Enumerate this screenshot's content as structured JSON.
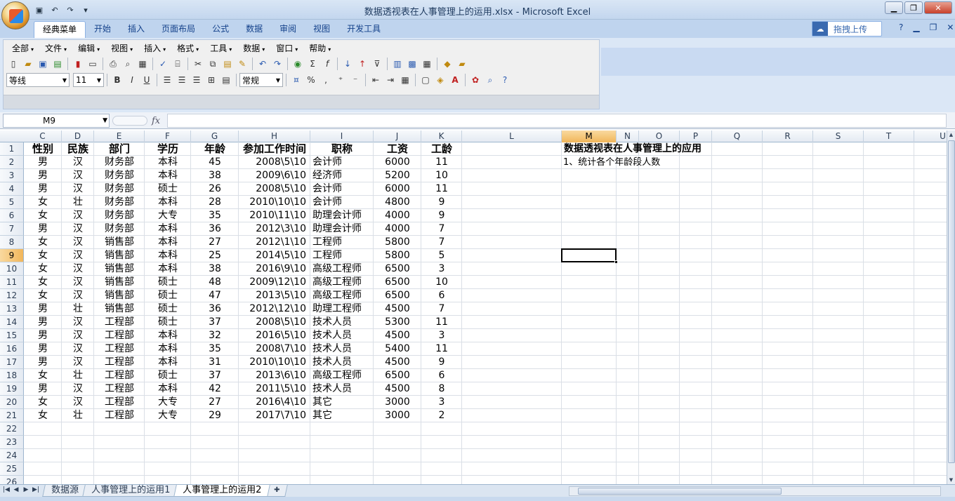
{
  "window": {
    "title": "数据透视表在人事管理上的运用.xlsx - Microsoft Excel",
    "controls": {
      "minimize": "▁",
      "restore": "❐",
      "close": "✕"
    }
  },
  "ribbon_tabs": [
    "经典菜单",
    "开始",
    "插入",
    "页面布局",
    "公式",
    "数据",
    "审阅",
    "视图",
    "开发工具"
  ],
  "upload_button": "拖拽上传",
  "classic_menu": [
    "全部",
    "文件",
    "编辑",
    "视图",
    "插入",
    "格式",
    "工具",
    "数据",
    "窗口",
    "帮助"
  ],
  "format_bar": {
    "font": "等线",
    "size": "11",
    "number_format": "常规"
  },
  "name_box": "M9",
  "fx_label": "fx",
  "columns": [
    "C",
    "D",
    "E",
    "F",
    "G",
    "H",
    "I",
    "J",
    "K",
    "L",
    "M",
    "N",
    "O",
    "P",
    "Q",
    "R",
    "S",
    "T",
    "U"
  ],
  "rows": [
    "1",
    "2",
    "3",
    "4",
    "5",
    "6",
    "7",
    "8",
    "9",
    "10",
    "11",
    "12",
    "13",
    "14",
    "15",
    "16",
    "17",
    "18",
    "19",
    "20",
    "21",
    "22",
    "23",
    "24",
    "25",
    "26"
  ],
  "selected_cell": {
    "col": "M",
    "row": "9"
  },
  "table": {
    "headers": [
      "性别",
      "民族",
      "部门",
      "学历",
      "年龄",
      "参加工作时间",
      "职称",
      "工资",
      "工龄"
    ],
    "rows": [
      [
        "男",
        "汉",
        "财务部",
        "本科",
        "45",
        "2008\\5\\10",
        "会计师",
        "6000",
        "11"
      ],
      [
        "男",
        "汉",
        "财务部",
        "本科",
        "38",
        "2009\\6\\10",
        "经济师",
        "5200",
        "10"
      ],
      [
        "男",
        "汉",
        "财务部",
        "硕士",
        "26",
        "2008\\5\\10",
        "会计师",
        "6000",
        "11"
      ],
      [
        "女",
        "壮",
        "财务部",
        "本科",
        "28",
        "2010\\10\\10",
        "会计师",
        "4800",
        "9"
      ],
      [
        "女",
        "汉",
        "财务部",
        "大专",
        "35",
        "2010\\11\\10",
        "助理会计师",
        "4000",
        "9"
      ],
      [
        "男",
        "汉",
        "财务部",
        "本科",
        "36",
        "2012\\3\\10",
        "助理会计师",
        "4000",
        "7"
      ],
      [
        "女",
        "汉",
        "销售部",
        "本科",
        "27",
        "2012\\1\\10",
        "工程师",
        "5800",
        "7"
      ],
      [
        "女",
        "汉",
        "销售部",
        "本科",
        "25",
        "2014\\5\\10",
        "工程师",
        "5800",
        "5"
      ],
      [
        "女",
        "汉",
        "销售部",
        "本科",
        "38",
        "2016\\9\\10",
        "高级工程师",
        "6500",
        "3"
      ],
      [
        "女",
        "汉",
        "销售部",
        "硕士",
        "48",
        "2009\\12\\10",
        "高级工程师",
        "6500",
        "10"
      ],
      [
        "女",
        "汉",
        "销售部",
        "硕士",
        "47",
        "2013\\5\\10",
        "高级工程师",
        "6500",
        "6"
      ],
      [
        "男",
        "壮",
        "销售部",
        "硕士",
        "36",
        "2012\\12\\10",
        "助理工程师",
        "4500",
        "7"
      ],
      [
        "男",
        "汉",
        "工程部",
        "硕士",
        "37",
        "2008\\5\\10",
        "技术人员",
        "5300",
        "11"
      ],
      [
        "男",
        "汉",
        "工程部",
        "本科",
        "32",
        "2016\\5\\10",
        "技术人员",
        "4500",
        "3"
      ],
      [
        "男",
        "汉",
        "工程部",
        "本科",
        "35",
        "2008\\7\\10",
        "技术人员",
        "5400",
        "11"
      ],
      [
        "男",
        "汉",
        "工程部",
        "本科",
        "31",
        "2010\\10\\10",
        "技术人员",
        "4500",
        "9"
      ],
      [
        "女",
        "壮",
        "工程部",
        "硕士",
        "37",
        "2013\\6\\10",
        "高级工程师",
        "6500",
        "6"
      ],
      [
        "男",
        "汉",
        "工程部",
        "本科",
        "42",
        "2011\\5\\10",
        "技术人员",
        "4500",
        "8"
      ],
      [
        "女",
        "汉",
        "工程部",
        "大专",
        "27",
        "2016\\4\\10",
        "其它",
        "3000",
        "3"
      ],
      [
        "女",
        "壮",
        "工程部",
        "大专",
        "29",
        "2017\\7\\10",
        "其它",
        "3000",
        "2"
      ]
    ]
  },
  "side_note": {
    "title": "数据透视表在人事管理上的应用",
    "subtitle": "1、统计各个年龄段人数"
  },
  "sheet_tabs": [
    "数据源",
    "人事管理上的运用1",
    "人事管理上的运用2"
  ],
  "active_sheet_index": 2
}
